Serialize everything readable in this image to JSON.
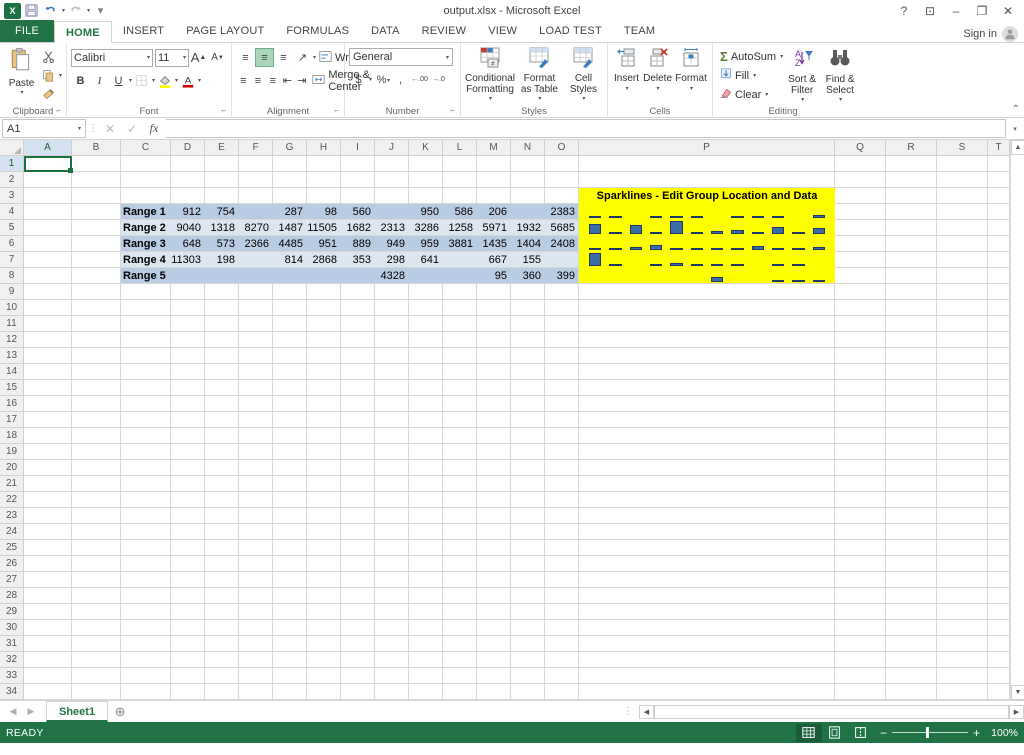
{
  "window": {
    "title": "output.xlsx - Microsoft Excel",
    "help_icon": "?",
    "ribbon_display_icon": "⊡",
    "minimize_icon": "–",
    "restore_icon": "❐",
    "close_icon": "✕"
  },
  "qat": {
    "logo": "X",
    "save_icon": "💾",
    "undo_icon": "↰",
    "redo_icon": "↱",
    "more_icon": "▾"
  },
  "tabs": [
    {
      "label": "FILE",
      "type": "file"
    },
    {
      "label": "HOME",
      "type": "active"
    },
    {
      "label": "INSERT",
      "type": "normal"
    },
    {
      "label": "PAGE LAYOUT",
      "type": "normal"
    },
    {
      "label": "FORMULAS",
      "type": "normal"
    },
    {
      "label": "DATA",
      "type": "normal"
    },
    {
      "label": "REVIEW",
      "type": "normal"
    },
    {
      "label": "VIEW",
      "type": "normal"
    },
    {
      "label": "LOAD TEST",
      "type": "normal"
    },
    {
      "label": "TEAM",
      "type": "normal"
    }
  ],
  "signin": {
    "label": "Sign in",
    "avatar_icon": "person-icon"
  },
  "ribbon": {
    "collapse_icon": "⌃",
    "clipboard": {
      "label": "Clipboard",
      "paste": "Paste",
      "cut_icon": "✂",
      "copy_icon": "⎘",
      "format_painter_icon": "🖌",
      "dialog_icon": "⌐"
    },
    "font": {
      "label": "Font",
      "font_name": "Calibri",
      "font_size": "11",
      "grow_icon": "A",
      "shrink_icon": "A",
      "bold": "B",
      "italic": "I",
      "underline": "U",
      "border_icon": "⊞",
      "fill_icon": "A",
      "color_icon": "A",
      "dialog_icon": "⌐"
    },
    "alignment": {
      "label": "Alignment",
      "wrap_text": "Wrap Text",
      "merge_center": "Merge & Center",
      "orientation_icon": "↗",
      "dialog_icon": "⌐"
    },
    "number": {
      "label": "Number",
      "format": "General",
      "currency_icon": "$",
      "percent_icon": "%",
      "comma_icon": ",",
      "inc_decimal_icon": ".00",
      "dec_decimal_icon": ".0",
      "dialog_icon": "⌐"
    },
    "styles": {
      "label": "Styles",
      "conditional_formatting": "Conditional Formatting",
      "format_as_table": "Format as Table",
      "cell_styles": "Cell Styles"
    },
    "cells": {
      "label": "Cells",
      "insert": "Insert",
      "delete": "Delete",
      "format": "Format"
    },
    "editing": {
      "label": "Editing",
      "autosum": "AutoSum",
      "fill": "Fill",
      "clear": "Clear",
      "sort_filter": "Sort & Filter",
      "find_select": "Find & Select",
      "sum_icon": "Σ"
    }
  },
  "formula_bar": {
    "name_box": "A1",
    "cancel_icon": "✕",
    "enter_icon": "✓",
    "function_icon": "fx",
    "value": "",
    "expand_icon": "▾"
  },
  "grid": {
    "columns": [
      "A",
      "B",
      "C",
      "D",
      "E",
      "F",
      "G",
      "H",
      "I",
      "J",
      "K",
      "L",
      "M",
      "N",
      "O",
      "P",
      "Q",
      "R",
      "S",
      "T"
    ],
    "rows": [
      1,
      2,
      3,
      4,
      5,
      6,
      7,
      8,
      9,
      10,
      11,
      12,
      13,
      14,
      15,
      16,
      17,
      18,
      19,
      20,
      21,
      22,
      23,
      24,
      25,
      26,
      27,
      28,
      29,
      30,
      31,
      32,
      33,
      34
    ],
    "selected_cell": "A1",
    "sparkline_title": "Sparklines - Edit Group Location and Data",
    "highlight_color": "#ffff00",
    "band_fill_odd": "#b8cce4",
    "band_fill_even": "#dce6f1",
    "data_rows": [
      {
        "row": 4,
        "label": "Range 1",
        "values": {
          "D": "912",
          "E": "754",
          "F": "",
          "G": "287",
          "H": "98",
          "I": "560",
          "J": "",
          "K": "950",
          "L": "586",
          "M": "206",
          "N": "",
          "O": "2383"
        }
      },
      {
        "row": 5,
        "label": "Range 2",
        "values": {
          "D": "9040",
          "E": "1318",
          "F": "8270",
          "G": "1487",
          "H": "11505",
          "I": "1682",
          "J": "2313",
          "K": "3286",
          "L": "1258",
          "M": "5971",
          "N": "1932",
          "O": "5685"
        }
      },
      {
        "row": 6,
        "label": "Range 3",
        "values": {
          "D": "648",
          "E": "573",
          "F": "2366",
          "G": "4485",
          "H": "951",
          "I": "889",
          "J": "949",
          "K": "959",
          "L": "3881",
          "M": "1435",
          "N": "1404",
          "O": "2408"
        }
      },
      {
        "row": 7,
        "label": "Range 4",
        "values": {
          "D": "11303",
          "E": "198",
          "F": "",
          "G": "814",
          "H": "2868",
          "I": "353",
          "J": "298",
          "K": "641",
          "L": "",
          "M": "667",
          "N": "155",
          "O": ""
        }
      },
      {
        "row": 8,
        "label": "Range 5",
        "values": {
          "D": "",
          "E": "",
          "F": "",
          "G": "",
          "H": "",
          "I": "",
          "J": "4328",
          "K": "",
          "L": "",
          "M": "95",
          "N": "360",
          "O": "399"
        }
      }
    ]
  },
  "chart_data": {
    "type": "bar",
    "title": "Sparklines - Edit Group Location and Data",
    "note": "Five column-sparkline groups rendered in merged range P4:P8 over a yellow fill; each sparkline plots the 12 values of its row (columns D through O).",
    "categories": [
      "D",
      "E",
      "F",
      "G",
      "H",
      "I",
      "J",
      "K",
      "L",
      "M",
      "N",
      "O"
    ],
    "series": [
      {
        "name": "Range 1",
        "row": 4,
        "values": [
          912,
          754,
          null,
          287,
          98,
          560,
          null,
          950,
          586,
          206,
          null,
          2383
        ]
      },
      {
        "name": "Range 2",
        "row": 5,
        "values": [
          9040,
          1318,
          8270,
          1487,
          11505,
          1682,
          2313,
          3286,
          1258,
          5971,
          1932,
          5685
        ]
      },
      {
        "name": "Range 3",
        "row": 6,
        "values": [
          648,
          573,
          2366,
          4485,
          951,
          889,
          949,
          959,
          3881,
          1435,
          1404,
          2408
        ]
      },
      {
        "name": "Range 4",
        "row": 7,
        "values": [
          11303,
          198,
          null,
          814,
          2868,
          353,
          298,
          641,
          null,
          667,
          155,
          null
        ]
      },
      {
        "name": "Range 5",
        "row": 8,
        "values": [
          null,
          null,
          null,
          null,
          null,
          null,
          4328,
          null,
          null,
          95,
          360,
          399
        ]
      }
    ],
    "ylim": [
      0,
      11505
    ],
    "grid": false,
    "legend": "none",
    "series_color": "#3a6ea5",
    "background": "#ffff00"
  },
  "sheet_tabs": {
    "prev_icon": "◀",
    "next_icon": "▶",
    "sheets": [
      "Sheet1"
    ],
    "active_sheet": "Sheet1",
    "add_icon": "⊕"
  },
  "scrollbars": {
    "left_arrow": "◀",
    "right_arrow": "▶",
    "up_arrow": "▲",
    "down_arrow": "▼"
  },
  "status_bar": {
    "text": "READY",
    "normal_view_icon": "grid-icon",
    "page_layout_icon": "page-icon",
    "page_break_icon": "break-icon",
    "zoom_out": "−",
    "zoom_in": "+",
    "zoom_level": "100%"
  }
}
